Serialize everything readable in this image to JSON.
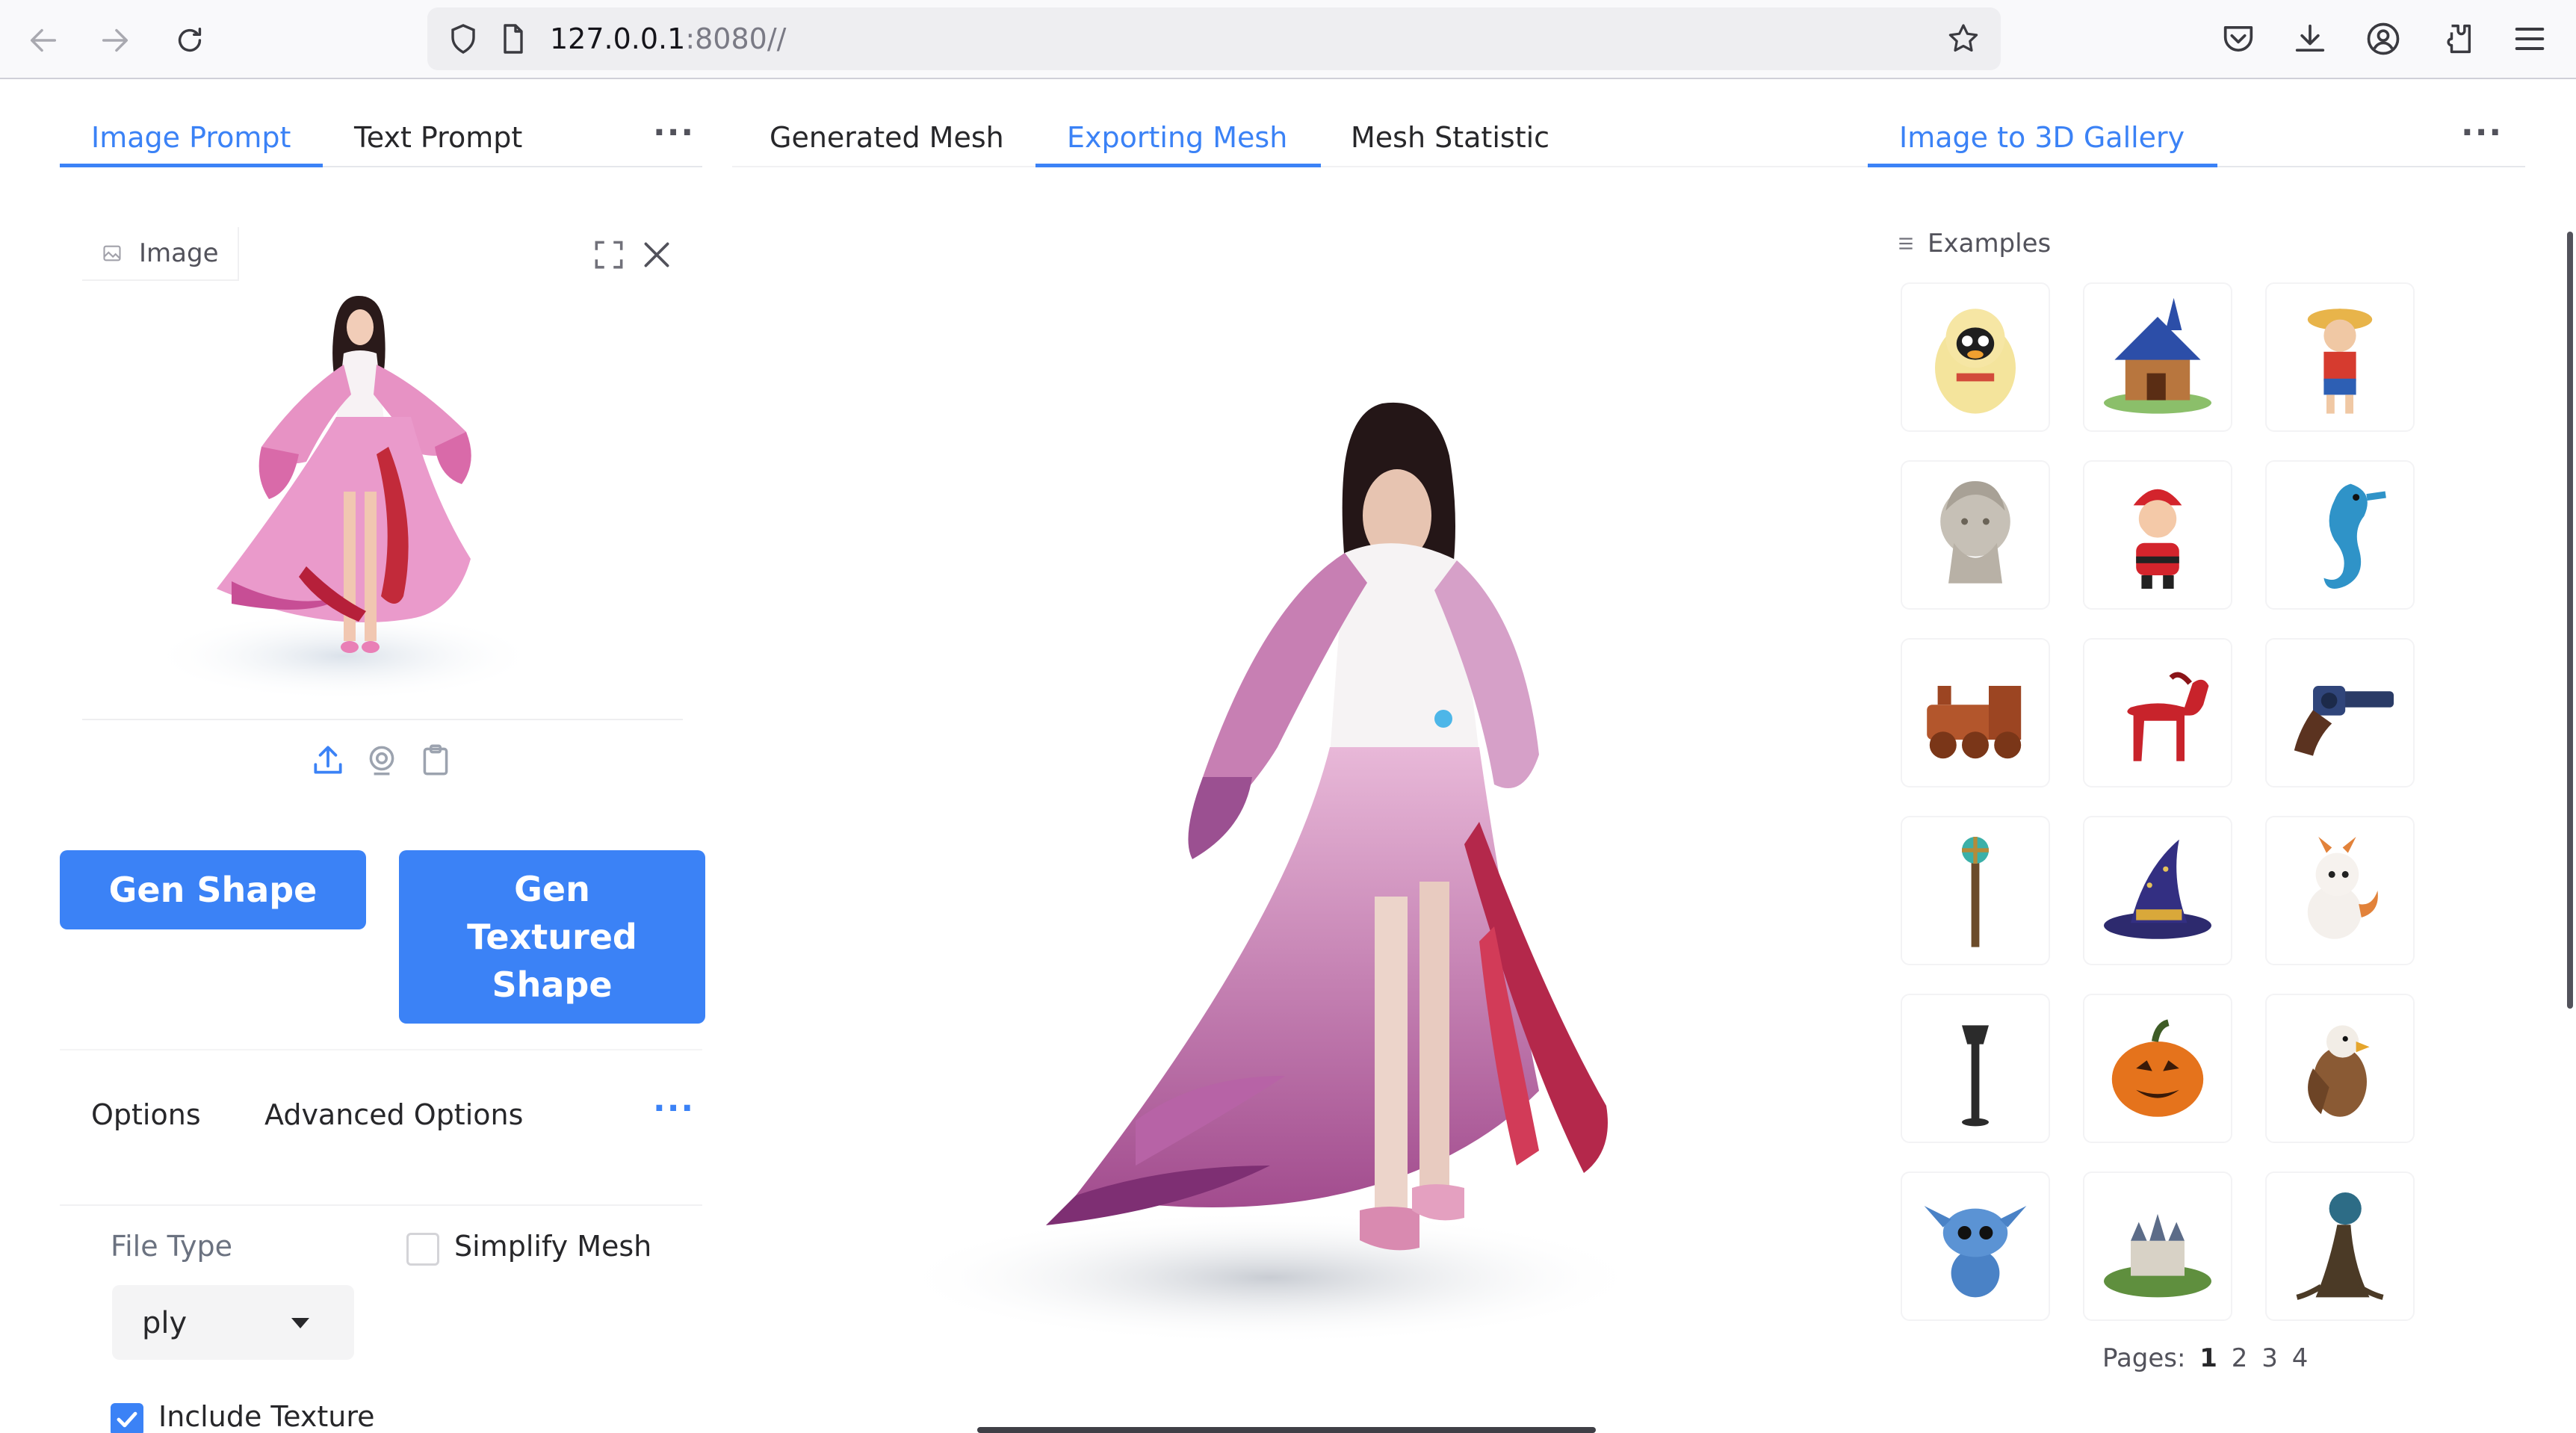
{
  "browser": {
    "url_host": "127.0.0.1",
    "url_rest": ":8080//"
  },
  "left_tabs": [
    "Image Prompt",
    "Text Prompt"
  ],
  "center_tabs": [
    "Generated Mesh",
    "Exporting Mesh",
    "Mesh Statistic"
  ],
  "right_tabs": [
    "Image to 3D Gallery"
  ],
  "image_block": {
    "label": "Image"
  },
  "buttons": {
    "gen_shape": "Gen Shape",
    "gen_textured_line1": "Gen",
    "gen_textured_line2": "Textured",
    "gen_textured_line3": "Shape"
  },
  "options": {
    "tabs": [
      "Options",
      "Advanced Options"
    ],
    "file_type_label": "File Type",
    "file_type_value": "ply",
    "simplify_label": "Simplify Mesh",
    "simplify_checked": false,
    "include_texture_label": "Include Texture",
    "include_texture_checked": true
  },
  "gallery": {
    "title": "Examples",
    "items": [
      "penguin-plush",
      "blue-house",
      "straw-hat-boy",
      "marble-bust",
      "santa",
      "seahorse",
      "steam-train",
      "red-horse",
      "revolver",
      "magic-staff",
      "wizard-hat",
      "baby-dragon",
      "street-lamp",
      "pumpkin",
      "eagle",
      "blue-alien",
      "castle-island",
      "tree-orb"
    ],
    "pages_label": "Pages:",
    "pages": [
      "1",
      "2",
      "3",
      "4"
    ],
    "current_page": "1"
  },
  "colors": {
    "accent": "#3b82f6",
    "text": "#27272a",
    "muted": "#6b7280"
  }
}
